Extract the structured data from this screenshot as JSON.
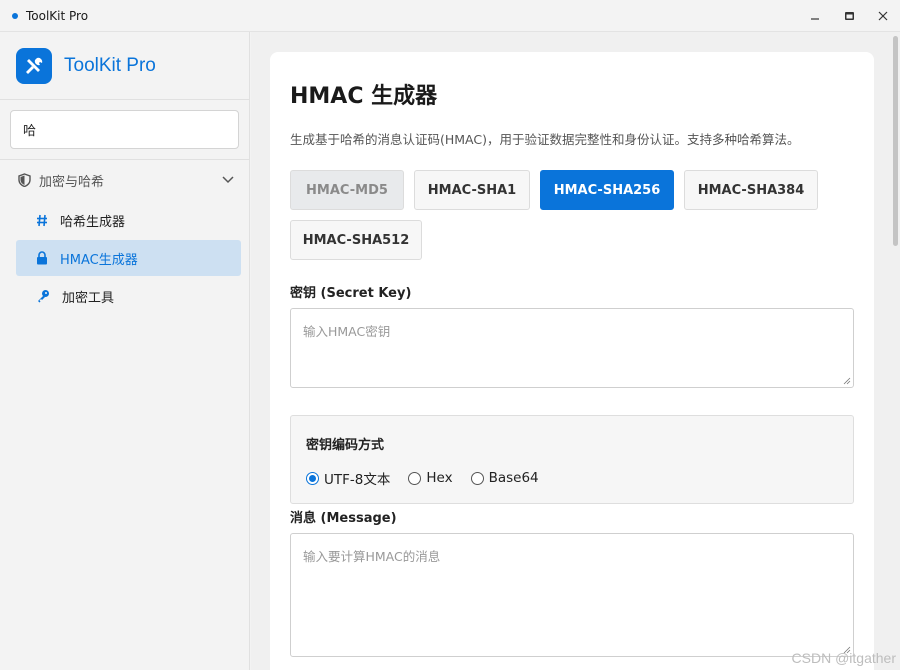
{
  "window": {
    "title": "ToolKit Pro"
  },
  "sidebar": {
    "brand": "ToolKit Pro",
    "search_value": "哈",
    "group": {
      "label": "加密与哈希"
    },
    "items": [
      {
        "label": "哈希生成器"
      },
      {
        "label": "HMAC生成器",
        "active": true
      },
      {
        "label": "加密工具"
      }
    ]
  },
  "main": {
    "title": "HMAC 生成器",
    "description": "生成基于哈希的消息认证码(HMAC)，用于验证数据完整性和身份认证。支持多种哈希算法。",
    "algorithms": [
      {
        "label": "HMAC-MD5",
        "state": "disabled"
      },
      {
        "label": "HMAC-SHA1",
        "state": "normal"
      },
      {
        "label": "HMAC-SHA256",
        "state": "selected"
      },
      {
        "label": "HMAC-SHA384",
        "state": "normal"
      },
      {
        "label": "HMAC-SHA512",
        "state": "normal"
      }
    ],
    "key": {
      "label": "密钥 (Secret Key)",
      "placeholder": "输入HMAC密钥"
    },
    "encoding": {
      "title": "密钥编码方式",
      "options": [
        "UTF-8文本",
        "Hex",
        "Base64"
      ],
      "selected": "UTF-8文本"
    },
    "message": {
      "label": "消息 (Message)",
      "placeholder": "输入要计算HMAC的消息"
    }
  },
  "watermark": "CSDN @itgather",
  "colors": {
    "accent": "#0a74da",
    "active_nav_bg": "#cde0f2"
  }
}
